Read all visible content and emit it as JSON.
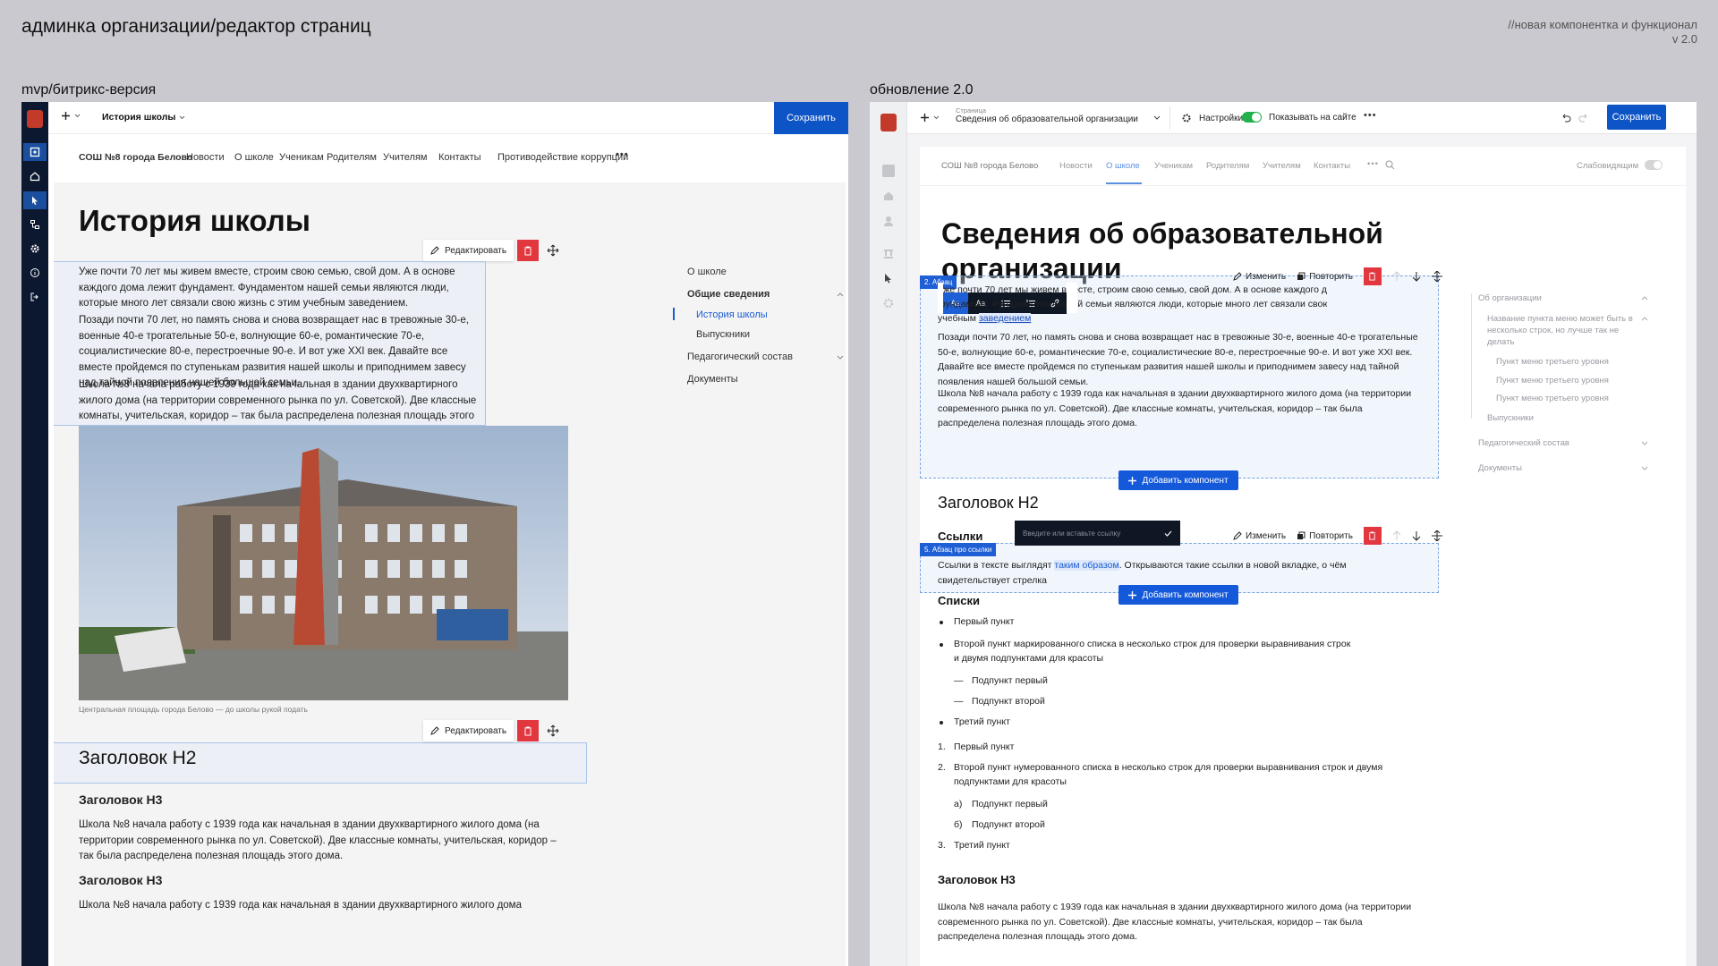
{
  "header": {
    "title": "админка организации/редактор страниц",
    "note_line1": "//новая компонентка и функционал",
    "note_line2": "v 2.0"
  },
  "left": {
    "label": "mvp/битрикс-версия",
    "topbar": {
      "page_title": "История школы",
      "save": "Сохранить"
    },
    "site": {
      "school": "СОШ №8 города Белово",
      "nav": [
        "Новости",
        "О школе",
        "Ученикам",
        "Родителям",
        "Учителям",
        "Контакты",
        "Противодействие коррупции"
      ]
    },
    "page": {
      "title": "История школы",
      "edit_label": "Редактировать",
      "p1": "Уже почти 70 лет мы живем вместе, строим свою семью, свой дом. А в основе каждого дома лежит фундамент. Фундаментом нашей семьи являются люди, которые много лет связали свою жизнь с этим учебным заведением.",
      "p2": "Позади почти 70 лет, но память снова и снова возвращает нас в тревожные 30-е, военные 40-е трогательные 50-е, волнующие 60-е, романтические 70-е, социалистические 80-е, перестроечные 90-е. И вот уже XXI век. Давайте все вместе пройдемся по ступенькам развития нашей школы и приподнимем завесу над тайной появления нашей большой семьи.",
      "p3": "Школа №8 начала работу с 1939 года как начальная в здании двухквартирного жилого дома (на территории современного рынка по ул. Советской). Две классные комнаты, учительская, коридор – так была распределена полезная площадь этого дома.",
      "caption": "Центральная площадь города Белово — до школы рукой подать",
      "h2": "Заголовок H2",
      "h3a": "Заголовок H3",
      "p4": "Школа №8 начала работу с 1939 года как начальная в здании двухквартирного жилого дома (на территории современного рынка по ул. Советской). Две классные комнаты, учительская, коридор – так была распределена полезная площадь этого дома.",
      "h3b": "Заголовок H3",
      "p5": "Школа №8 начала работу с 1939 года как начальная в здании двухквартирного жилого дома"
    },
    "toc": {
      "root": "О школе",
      "group": "Общие сведения",
      "items": [
        "История школы",
        "Выпускники"
      ],
      "group2": "Педагогический состав",
      "docs": "Документы"
    }
  },
  "right": {
    "label": "обновление 2.0",
    "topbar": {
      "page_caption": "Страница",
      "page_title": "Сведения об образовательной организации",
      "settings": "Настройки",
      "show_on_site": "Показывать на сайте",
      "save": "Сохранить"
    },
    "site": {
      "school": "СОШ №8 города Белово",
      "nav": [
        "Новости",
        "О школе",
        "Ученикам",
        "Родителям",
        "Учителям",
        "Контакты"
      ],
      "low_vision": "Слабовидящим"
    },
    "page": {
      "title_line1": "Сведения об образовательной",
      "title_line2": "организации",
      "tag1": "2. Абзац",
      "change": "Изменить",
      "repeat": "Повторить",
      "p1_l1": "Уже почти 70 лет мы живем вместе, строим свою семью, свой дом. А в основе каждого дома лежит",
      "p1_l2": "фундамент. Фундаментом нашей семьи являются люди, которые много лет связали свою жизнь с этим",
      "p1_l3a": "учебным",
      "p1_l3b": "заведением",
      "p2": "Позади почти 70 лет, но память снова и снова возвращает нас в тревожные 30-е, военные 40-е трогательные 50-е, волнующие 60-е, романтические 70-е, социалистические 80-е, перестроечные 90-е. И вот уже XXI век. Давайте все вместе пройдемся по ступенькам развития нашей школы и приподнимем завесу над тайной появления нашей большой семьи.",
      "p3": "Школа №8 начала работу с 1939 года как начальная в здании двухквартирного жилого дома (на территории современного рынка по ул. Советской). Две классные комнаты, учительская, коридор – так была распределена полезная площадь этого дома.",
      "add_component": "Добавить компонент",
      "h2": "Заголовок H2",
      "links_h": "Ссылки",
      "tag2": "5. Абзац про ссылки",
      "link_placeholder": "Введите или вставьте ссылку",
      "links_p_a": "Ссылки в тексте выглядят",
      "links_p_link": "таким образом",
      "links_p_b": ". Открываются такие ссылки в новой вкладке, о чём",
      "links_p_c": "свидетельствует стрелка",
      "lists_h": "Списки",
      "ul": [
        "Первый пункт",
        "Второй пункт маркированного списка в несколько строк для проверки выравнивания строк",
        "и двумя подпунктами для красоты",
        "Подпункт первый",
        "Подпункт второй",
        "Третий пункт"
      ],
      "ol": [
        "Первый пункт",
        "Второй пункт нумерованного списка в несколько строк для проверки выравнивания строк и двумя",
        "подпунктами для красоты",
        "Подпункт первый",
        "Подпункт второй",
        "Третий пункт"
      ],
      "ol_markers": [
        "1.",
        "2.",
        "а)",
        "б)",
        "3."
      ],
      "h3": "Заголовок H3",
      "p4": "Школа №8 начала работу с 1939 года как начальная в здании двухквартирного жилого дома (на территории современного рынка по ул. Советской). Две классные комнаты, учительская, коридор – так была распределена полезная площадь этого дома."
    },
    "toc": {
      "root": "Об организации",
      "item_long": "Название пункта меню может быть в несколько строк, но лучше так не делать",
      "sub": [
        "Пункт меню третьего уровня",
        "Пункт меню третьего уровня",
        "Пункт меню третьего уровня"
      ],
      "grads": "Выпускники",
      "teachers": "Педагогический состав",
      "docs": "Документы"
    }
  },
  "colors": {
    "accent": "#0d54c6",
    "danger": "#e2373f",
    "toggle": "#21b04b"
  }
}
